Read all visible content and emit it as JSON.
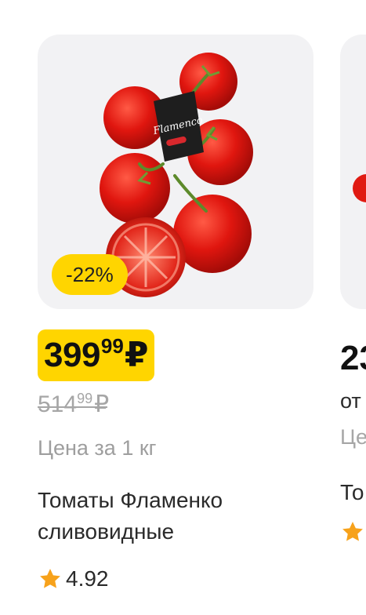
{
  "product": {
    "discount_label": "-22%",
    "price_integer": "399",
    "price_fraction": "99",
    "currency": "₽",
    "old_price_integer": "514",
    "old_price_fraction": "99",
    "unit_note": "Цена за 1 кг",
    "title": "Томаты Фламенко сливовидные",
    "rating": "4.92",
    "image_icon": "tomatoes-on-vine-image",
    "accent_color": "#ffd500",
    "star_color": "#f7a21b"
  },
  "next_card": {
    "price_partial": "23",
    "from_partial": "от",
    "unit_partial": "Це",
    "title_partial": "То"
  }
}
